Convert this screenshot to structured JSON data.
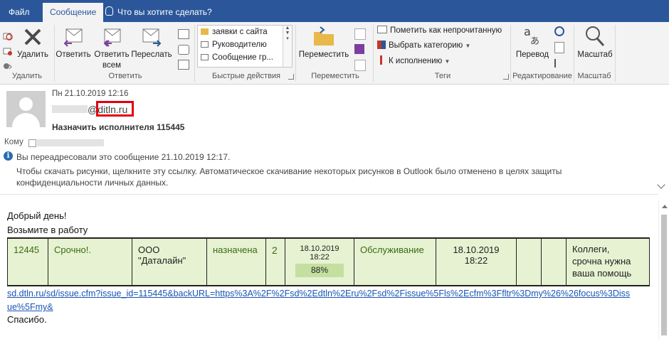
{
  "tabs": {
    "file": "Файл",
    "message": "Сообщение",
    "tell_me": "Что вы хотите сделать?"
  },
  "ribbon": {
    "delete_group": {
      "delete": "Удалить",
      "label": "Удалить"
    },
    "respond_group": {
      "reply": "Ответить",
      "reply_all_1": "Ответить",
      "reply_all_2": "всем",
      "forward": "Переслать",
      "label": "Ответить"
    },
    "quick_steps": {
      "items": [
        "заявки с сайта",
        "Руководителю",
        "Сообщение гр..."
      ],
      "label": "Быстрые действия"
    },
    "move_group": {
      "move": "Переместить",
      "label": "Переместить"
    },
    "tags_group": {
      "mark_unread": "Пометить как непрочитанную",
      "categorize": "Выбрать категорию",
      "followup": "К исполнению",
      "label": "Теги"
    },
    "editing_group": {
      "translate": "Перевод",
      "label": "Редактирование"
    },
    "zoom_group": {
      "zoom": "Масштаб",
      "label": "Масштаб"
    }
  },
  "message": {
    "date": "Пн 21.10.2019 12:16",
    "sender_domain": "@ditln.ru",
    "subject": "Назначить исполнителя 115445",
    "to_label": "Кому",
    "info_forwarded": "Вы переадресовали это сообщение 21.10.2019 12:17.",
    "info_pictures": "Чтобы скачать рисунки, щелкните эту ссылку. Автоматическое скачивание некоторых рисунков в Outlook было отменено в целях защиты конфиденциальности личных данных."
  },
  "body": {
    "greeting": "Добрый день!",
    "take": "Возьмите в работу",
    "row": {
      "id": "12445",
      "priority": "Срочно!.",
      "company_1": "ООО",
      "company_2": "\"Даталайн\"",
      "status": "назначена",
      "num": "2",
      "date_1": "18.10.2019",
      "time_1": "18:22",
      "percent": "88%",
      "service": "Обслуживание",
      "date_2": "18.10.2019",
      "time_2": "18:22",
      "comment_1": "Коллеги,",
      "comment_2": "срочна нужна",
      "comment_3": "ваша помощь"
    },
    "link": "sd.dtln.ru/sd/issue.cfm?issue_id=115445&backURL=https%3A%2F%2Fsd%2Edtln%2Eru%2Fsd%2Fissue%5Fls%2Ecfm%3Ffltr%3Dmy%26%26focus%3Dissue%5Fmy&",
    "thanks": "Спасибо."
  },
  "colors": {
    "accent": "#2b579a",
    "row_bg": "#e6f2d1",
    "highlight": "#e3000f",
    "link": "#1a55b4"
  }
}
